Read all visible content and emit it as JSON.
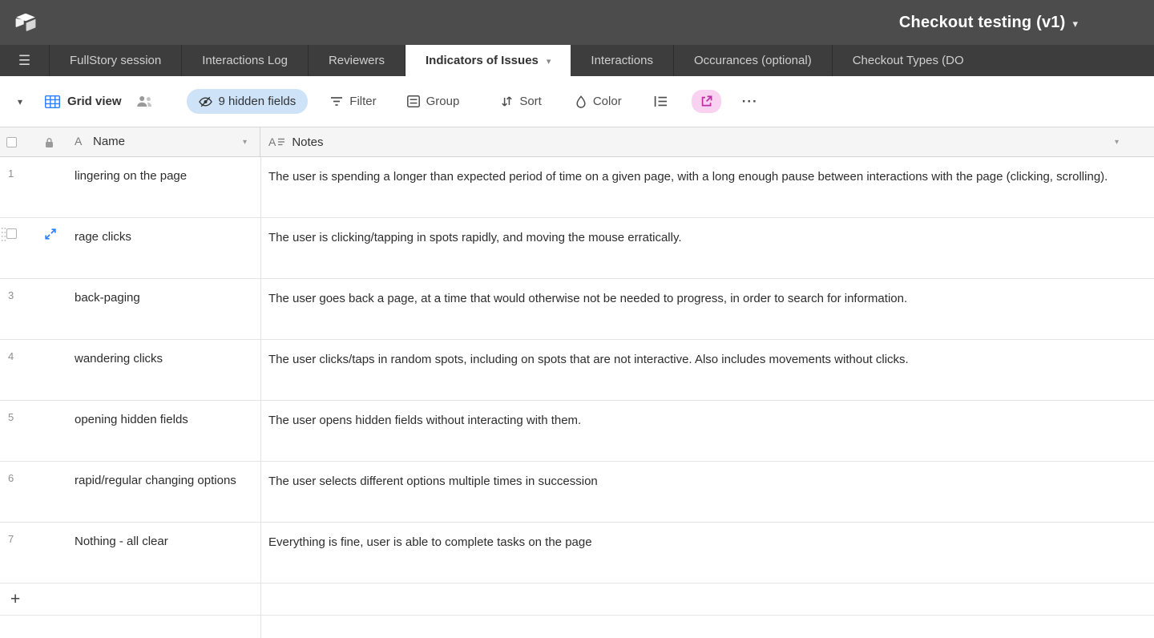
{
  "topbar": {
    "title": "Checkout testing (v1)"
  },
  "tabbar": {
    "tabs": [
      {
        "label": "FullStory session",
        "active": false
      },
      {
        "label": "Interactions Log",
        "active": false
      },
      {
        "label": "Reviewers",
        "active": false
      },
      {
        "label": "Indicators of Issues",
        "active": true
      },
      {
        "label": "Interactions",
        "active": false
      },
      {
        "label": "Occurances (optional)",
        "active": false
      },
      {
        "label": "Checkout Types (DO",
        "active": false
      }
    ]
  },
  "toolbar": {
    "view_name": "Grid view",
    "hidden_fields_label": "9 hidden fields",
    "filter_label": "Filter",
    "group_label": "Group",
    "sort_label": "Sort",
    "color_label": "Color",
    "more_label": "···"
  },
  "table": {
    "columns": [
      {
        "name": "Name",
        "type_icon": "single-line-text-icon",
        "lock_icon": "lock-icon"
      },
      {
        "name": "Notes",
        "type_icon": "long-text-icon"
      }
    ],
    "rows": [
      {
        "num": "1",
        "name": "lingering on the page",
        "notes": "The user is spending a longer than expected period of time on a given page, with a long enough pause between interactions with the page (clicking, scrolling)."
      },
      {
        "num": "",
        "name": "rage clicks",
        "notes": "The user is clicking/tapping in spots rapidly, and moving the mouse erratically.",
        "state": "hovered"
      },
      {
        "num": "3",
        "name": "back-paging",
        "notes": "The user goes back a page, at a time that would otherwise not be needed to progress, in order to search for information."
      },
      {
        "num": "4",
        "name": "wandering clicks",
        "notes": "The user clicks/taps in random spots, including on spots that are not interactive. Also includes movements without clicks."
      },
      {
        "num": "5",
        "name": "opening hidden fields",
        "notes": "The user opens hidden fields without interacting with them."
      },
      {
        "num": "6",
        "name": "rapid/regular changing options",
        "notes": "The user selects different options multiple times in succession"
      },
      {
        "num": "7",
        "name": "Nothing - all clear",
        "notes": "Everything is fine, user is able to complete tasks on the page"
      }
    ],
    "add_row_label": "+"
  },
  "colors": {
    "accent_blue": "#2d7ff9",
    "hidden_fields_button_bg": "#cfe3f8",
    "share_button_bg": "#f9d2f1",
    "share_icon": "#c12ba8",
    "topbar_bg": "#4c4c4c",
    "tabbar_bg": "#3d3d3d"
  }
}
